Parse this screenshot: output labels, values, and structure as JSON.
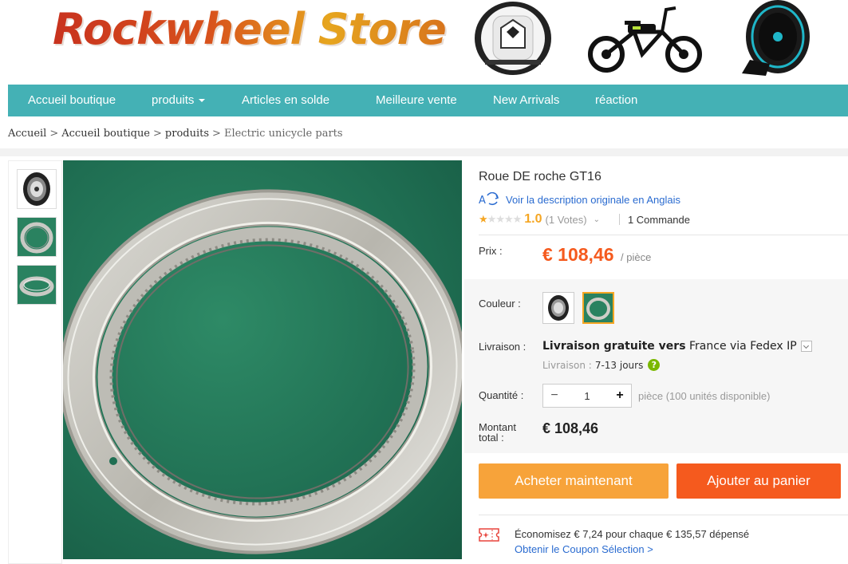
{
  "header": {
    "store_name": "Rockwheel Store"
  },
  "nav": {
    "items": [
      {
        "label": "Accueil boutique"
      },
      {
        "label": "produits"
      },
      {
        "label": "Articles en solde"
      },
      {
        "label": "Meilleure vente"
      },
      {
        "label": "New Arrivals"
      },
      {
        "label": "réaction"
      }
    ]
  },
  "breadcrumb": {
    "items": [
      "Accueil",
      "Accueil boutique",
      "produits"
    ],
    "current": "Electric unicycle parts",
    "separator": ">"
  },
  "product": {
    "title": "Roue DE roche GT16",
    "translate_link": "Voir la description originale en Anglais",
    "rating_value": "1.0",
    "stars_filled": 1,
    "stars_total": 5,
    "votes": "(1 Votes)",
    "orders": "1 Commande",
    "price_label": "Prix :",
    "price": "€ 108,46",
    "price_unit": "/ pièce",
    "color_label": "Couleur :",
    "shipping_label": "Livraison :",
    "shipping_free": "Livraison gratuite vers",
    "shipping_dest": "France via Fedex IP",
    "delivery_label": "Livraison :",
    "delivery_days": "7-13 jours",
    "quantity_label": "Quantité :",
    "quantity_value": "1",
    "quantity_available": "pièce (100 unités disponible)",
    "total_label_line1": "Montant",
    "total_label_line2": "total :",
    "total": "€ 108,46",
    "buy_now": "Acheter maintenant",
    "add_to_cart": "Ajouter au panier",
    "coupon_text": "Économisez € 7,24 pour chaque € 135,57 dépensé",
    "coupon_link": "Obtenir le Coupon Sélection >"
  },
  "colors": {
    "accent_nav": "#44b1b5",
    "price": "#f55a1e",
    "buy_button": "#f7a33a",
    "cart_button": "#f55a1e",
    "link": "#2a6bd0",
    "star": "#f5a623"
  },
  "icons": [
    "translate-icon",
    "star-icon",
    "chevron-down-icon",
    "question-icon",
    "minus-icon",
    "plus-icon",
    "coupon-icon"
  ]
}
